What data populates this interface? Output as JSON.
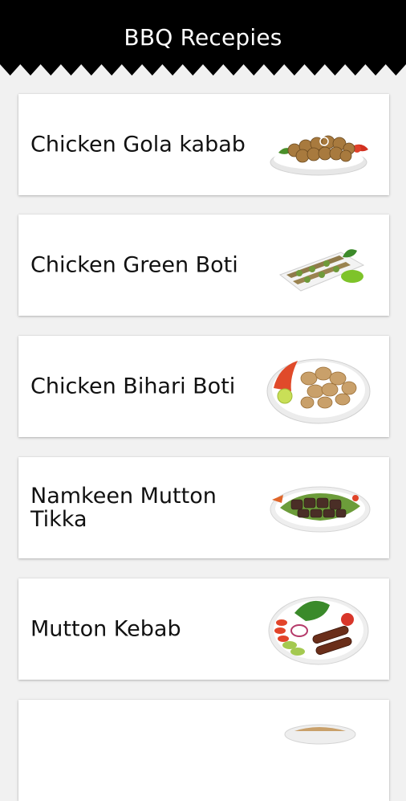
{
  "header": {
    "title": "BBQ Recepies"
  },
  "recipes": [
    {
      "label": "Chicken Gola kabab",
      "icon": "gola-kabab-plate-icon"
    },
    {
      "label": "Chicken Green Boti",
      "icon": "green-boti-platter-icon"
    },
    {
      "label": "Chicken Bihari Boti",
      "icon": "bihari-boti-plate-icon"
    },
    {
      "label": "Namkeen Mutton Tikka",
      "icon": "mutton-tikka-plate-icon"
    },
    {
      "label": "Mutton Kebab",
      "icon": "mutton-kebab-plate-icon"
    },
    {
      "label": "",
      "icon": "partial-dish-icon"
    }
  ],
  "colors": {
    "header_bg": "#000000",
    "page_bg": "#f1f1f1",
    "card_bg": "#ffffff",
    "text": "#111111"
  }
}
